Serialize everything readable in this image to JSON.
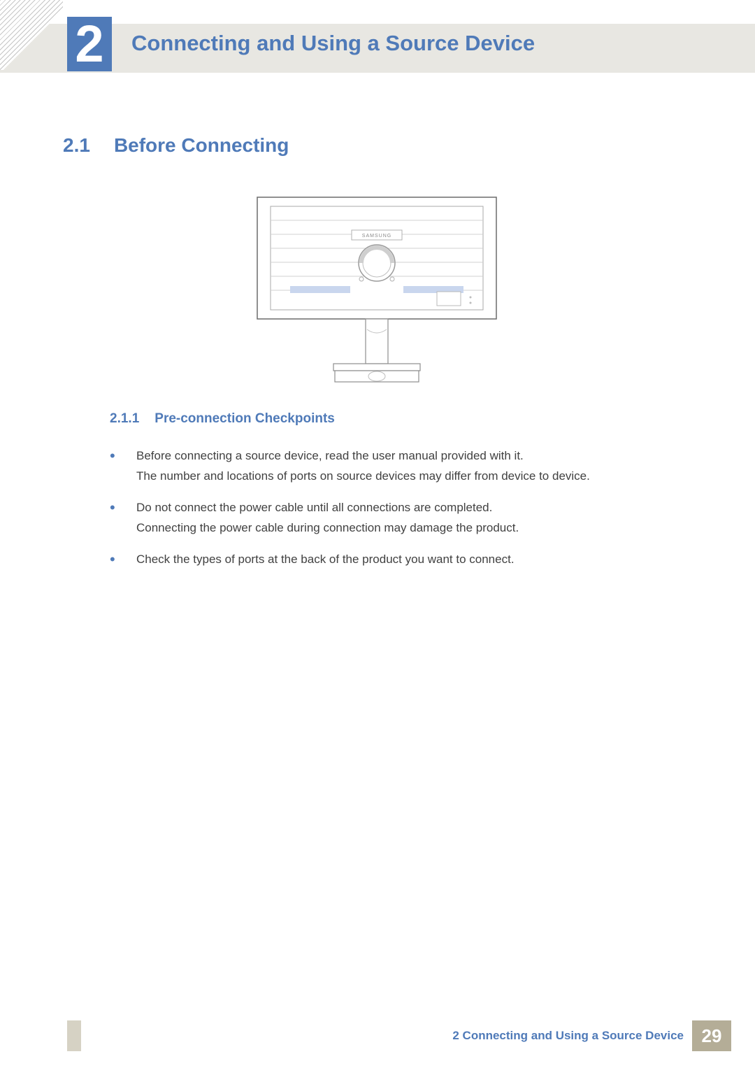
{
  "chapter": {
    "number": "2",
    "title": "Connecting and Using a Source Device"
  },
  "section": {
    "number": "2.1",
    "title": "Before Connecting"
  },
  "illustration": {
    "brand_label": "SAMSUNG"
  },
  "subsection": {
    "number": "2.1.1",
    "title": "Pre-connection Checkpoints"
  },
  "bullets": [
    {
      "lines": [
        "Before connecting a source device, read the user manual provided with it.",
        "The number and locations of ports on source devices may differ from device to device."
      ]
    },
    {
      "lines": [
        "Do not connect the power cable until all connections are completed.",
        "Connecting the power cable during connection may damage the product."
      ]
    },
    {
      "lines": [
        "Check the types of ports at the back of the product you want to connect."
      ]
    }
  ],
  "footer": {
    "text": "2 Connecting and Using a Source Device",
    "page": "29"
  }
}
